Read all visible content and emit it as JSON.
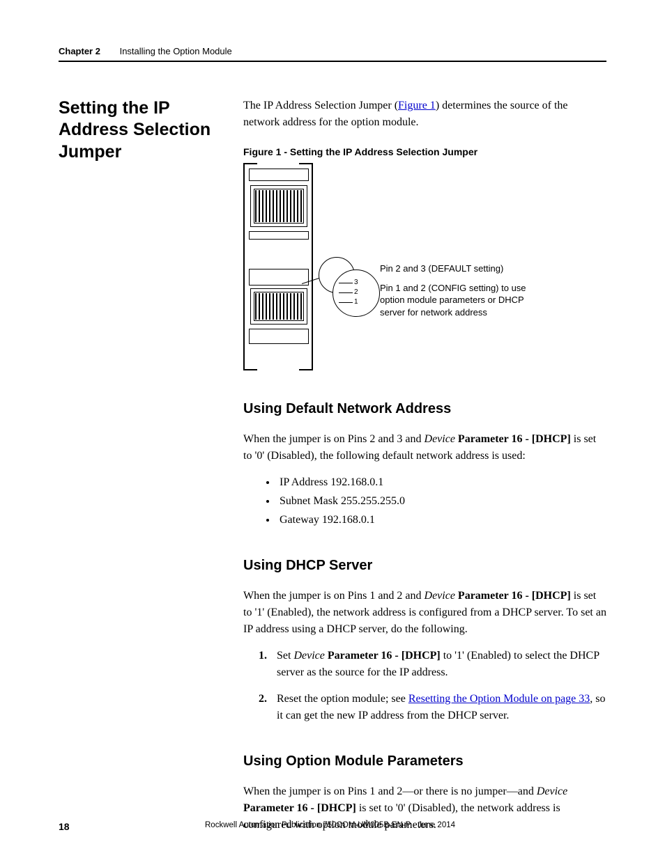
{
  "header": {
    "chapter": "Chapter 2",
    "title": "Installing the Option Module"
  },
  "main_heading": "Setting the IP Address Selection Jumper",
  "intro": {
    "pre": "The IP Address Selection Jumper (",
    "link": "Figure 1",
    "post": ") determines the source of the network address for the option module."
  },
  "figure": {
    "caption": "Figure 1 - Setting the IP Address Selection Jumper",
    "annot1": "Pin 2 and 3 (DEFAULT setting)",
    "annot2": "Pin 1 and 2 (CONFIG setting) to use option module parameters or DHCP server for network address",
    "pin3": "3",
    "pin2": "2",
    "pin1": "1"
  },
  "sec1": {
    "heading": "Using Default Network Address",
    "p1a": "When the jumper is on Pins 2 and 3 and ",
    "p1b": "Device",
    "p1c": " Parameter 16 - [DHCP]",
    "p1d": " is set to '0' (Disabled), the following default network address is used:",
    "bullets": [
      "IP Address 192.168.0.1",
      "Subnet Mask 255.255.255.0",
      "Gateway 192.168.0.1"
    ]
  },
  "sec2": {
    "heading": "Using DHCP Server",
    "p1a": "When the jumper is on Pins 1 and 2 and ",
    "p1b": "Device",
    "p1c": " Parameter 16 - [DHCP]",
    "p1d": " is set to '1' (Enabled), the network address is configured from a DHCP server. To set an IP address using a DHCP server, do the following.",
    "step1a": "Set ",
    "step1b": "Device",
    "step1c": " Parameter 16 - [DHCP]",
    "step1d": " to '1' (Enabled) to select the DHCP server as the source for the IP address.",
    "step2a": "Reset the option module; see ",
    "step2link": "Resetting the Option Module on page 33",
    "step2b": ", so it can get the new IP address from the DHCP server."
  },
  "sec3": {
    "heading": "Using Option Module Parameters",
    "p1a": "When the jumper is on Pins 1 and 2—or there is no jumper—and ",
    "p1b": "Device",
    "p1c": " Parameter 16 - [DHCP]",
    "p1d": " is set to '0' (Disabled), the network address is configured with option module parameters."
  },
  "footer": {
    "page": "18",
    "pub": "Rockwell Automation Publication 750COM-UM005B-EN-P - June 2014"
  }
}
